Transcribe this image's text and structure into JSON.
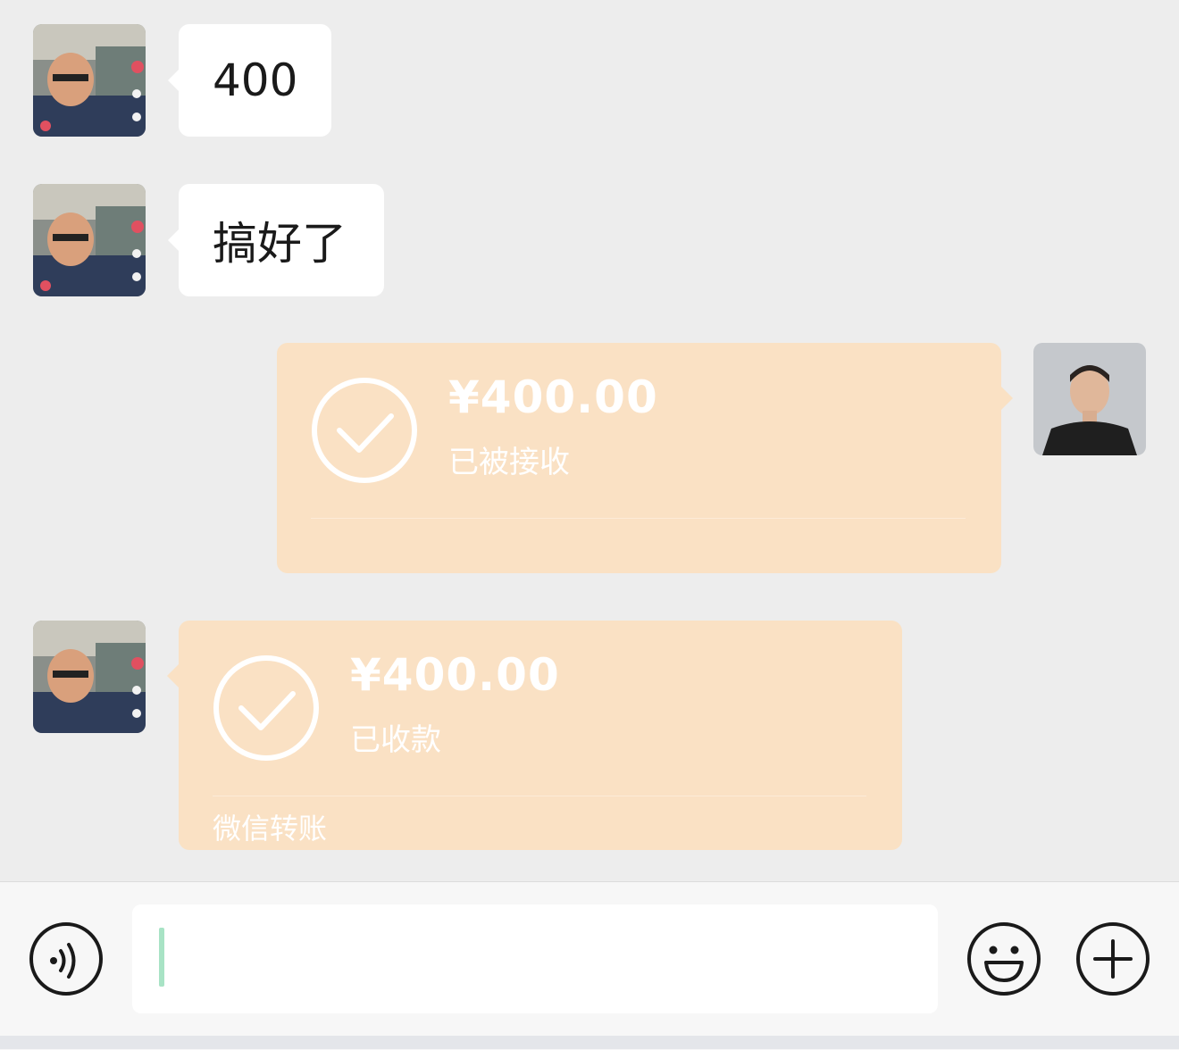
{
  "messages": [
    {
      "sender": "contact",
      "type": "text",
      "text": "400"
    },
    {
      "sender": "contact",
      "type": "text",
      "text": "搞好了"
    },
    {
      "sender": "me",
      "type": "transfer",
      "amount": "¥400.00",
      "status": "已被接收",
      "icon": "check-circle-icon"
    },
    {
      "sender": "contact",
      "type": "transfer",
      "amount": "¥400.00",
      "status": "已收款",
      "footer": "微信转账",
      "icon": "check-circle-icon"
    }
  ],
  "input_bar": {
    "voice_icon": "voice-icon",
    "input_value": "",
    "emoji_icon": "emoji-icon",
    "plus_icon": "plus-icon"
  },
  "colors": {
    "background": "#ededed",
    "bubble": "#ffffff",
    "transfer_received": "#fae1c4",
    "caret": "#a8e3c5"
  }
}
